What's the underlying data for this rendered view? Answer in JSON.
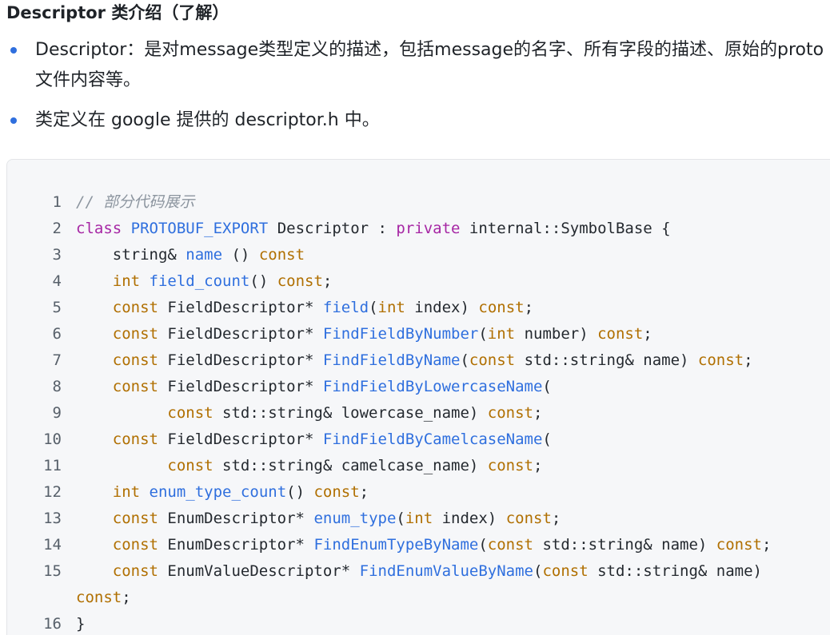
{
  "heading": "Descriptor 类介绍（了解）",
  "bullets": [
    "Descriptor：是对message类型定义的描述，包括message的名字、所有字段的描述、原始的proto文件内容等。",
    "类定义在 google 提供的 descriptor.h 中。"
  ],
  "code": {
    "lines": [
      {
        "num": "1",
        "tokens": [
          {
            "t": "// 部分代码展示",
            "c": "comment"
          }
        ]
      },
      {
        "num": "2",
        "tokens": [
          {
            "t": "class",
            "c": "keyword"
          },
          {
            "t": " ",
            "c": "plain"
          },
          {
            "t": "PROTOBUF_EXPORT",
            "c": "func"
          },
          {
            "t": " Descriptor : ",
            "c": "plain"
          },
          {
            "t": "private",
            "c": "keyword"
          },
          {
            "t": " internal::SymbolBase {",
            "c": "plain"
          }
        ]
      },
      {
        "num": "3",
        "tokens": [
          {
            "t": "    string& ",
            "c": "plain"
          },
          {
            "t": "name",
            "c": "func"
          },
          {
            "t": " () ",
            "c": "plain"
          },
          {
            "t": "const",
            "c": "type"
          }
        ]
      },
      {
        "num": "4",
        "tokens": [
          {
            "t": "    ",
            "c": "plain"
          },
          {
            "t": "int",
            "c": "type"
          },
          {
            "t": " ",
            "c": "plain"
          },
          {
            "t": "field_count",
            "c": "func"
          },
          {
            "t": "() ",
            "c": "plain"
          },
          {
            "t": "const",
            "c": "type"
          },
          {
            "t": ";",
            "c": "plain"
          }
        ]
      },
      {
        "num": "5",
        "tokens": [
          {
            "t": "    ",
            "c": "plain"
          },
          {
            "t": "const",
            "c": "type"
          },
          {
            "t": " FieldDescriptor* ",
            "c": "plain"
          },
          {
            "t": "field",
            "c": "func"
          },
          {
            "t": "(",
            "c": "plain"
          },
          {
            "t": "int",
            "c": "type"
          },
          {
            "t": " index) ",
            "c": "plain"
          },
          {
            "t": "const",
            "c": "type"
          },
          {
            "t": ";",
            "c": "plain"
          }
        ]
      },
      {
        "num": "6",
        "tokens": [
          {
            "t": "    ",
            "c": "plain"
          },
          {
            "t": "const",
            "c": "type"
          },
          {
            "t": " FieldDescriptor* ",
            "c": "plain"
          },
          {
            "t": "FindFieldByNumber",
            "c": "func"
          },
          {
            "t": "(",
            "c": "plain"
          },
          {
            "t": "int",
            "c": "type"
          },
          {
            "t": " number) ",
            "c": "plain"
          },
          {
            "t": "const",
            "c": "type"
          },
          {
            "t": ";",
            "c": "plain"
          }
        ]
      },
      {
        "num": "7",
        "tokens": [
          {
            "t": "    ",
            "c": "plain"
          },
          {
            "t": "const",
            "c": "type"
          },
          {
            "t": " FieldDescriptor* ",
            "c": "plain"
          },
          {
            "t": "FindFieldByName",
            "c": "func"
          },
          {
            "t": "(",
            "c": "plain"
          },
          {
            "t": "const",
            "c": "type"
          },
          {
            "t": " std::string& name) ",
            "c": "plain"
          },
          {
            "t": "const",
            "c": "type"
          },
          {
            "t": ";",
            "c": "plain"
          }
        ]
      },
      {
        "num": "8",
        "tokens": [
          {
            "t": "    ",
            "c": "plain"
          },
          {
            "t": "const",
            "c": "type"
          },
          {
            "t": " FieldDescriptor* ",
            "c": "plain"
          },
          {
            "t": "FindFieldByLowercaseName",
            "c": "func"
          },
          {
            "t": "(",
            "c": "plain"
          }
        ]
      },
      {
        "num": "9",
        "tokens": [
          {
            "t": "          ",
            "c": "plain"
          },
          {
            "t": "const",
            "c": "type"
          },
          {
            "t": " std::string& lowercase_name) ",
            "c": "plain"
          },
          {
            "t": "const",
            "c": "type"
          },
          {
            "t": ";",
            "c": "plain"
          }
        ]
      },
      {
        "num": "10",
        "tokens": [
          {
            "t": "    ",
            "c": "plain"
          },
          {
            "t": "const",
            "c": "type"
          },
          {
            "t": " FieldDescriptor* ",
            "c": "plain"
          },
          {
            "t": "FindFieldByCamelcaseName",
            "c": "func"
          },
          {
            "t": "(",
            "c": "plain"
          }
        ]
      },
      {
        "num": "11",
        "tokens": [
          {
            "t": "          ",
            "c": "plain"
          },
          {
            "t": "const",
            "c": "type"
          },
          {
            "t": " std::string& camelcase_name) ",
            "c": "plain"
          },
          {
            "t": "const",
            "c": "type"
          },
          {
            "t": ";",
            "c": "plain"
          }
        ]
      },
      {
        "num": "12",
        "tokens": [
          {
            "t": "    ",
            "c": "plain"
          },
          {
            "t": "int",
            "c": "type"
          },
          {
            "t": " ",
            "c": "plain"
          },
          {
            "t": "enum_type_count",
            "c": "func"
          },
          {
            "t": "() ",
            "c": "plain"
          },
          {
            "t": "const",
            "c": "type"
          },
          {
            "t": ";",
            "c": "plain"
          }
        ]
      },
      {
        "num": "13",
        "tokens": [
          {
            "t": "    ",
            "c": "plain"
          },
          {
            "t": "const",
            "c": "type"
          },
          {
            "t": " EnumDescriptor* ",
            "c": "plain"
          },
          {
            "t": "enum_type",
            "c": "func"
          },
          {
            "t": "(",
            "c": "plain"
          },
          {
            "t": "int",
            "c": "type"
          },
          {
            "t": " index) ",
            "c": "plain"
          },
          {
            "t": "const",
            "c": "type"
          },
          {
            "t": ";",
            "c": "plain"
          }
        ]
      },
      {
        "num": "14",
        "tokens": [
          {
            "t": "    ",
            "c": "plain"
          },
          {
            "t": "const",
            "c": "type"
          },
          {
            "t": " EnumDescriptor* ",
            "c": "plain"
          },
          {
            "t": "FindEnumTypeByName",
            "c": "func"
          },
          {
            "t": "(",
            "c": "plain"
          },
          {
            "t": "const",
            "c": "type"
          },
          {
            "t": " std::string& name) ",
            "c": "plain"
          },
          {
            "t": "const",
            "c": "type"
          },
          {
            "t": ";",
            "c": "plain"
          }
        ]
      },
      {
        "num": "15",
        "wrapped": true,
        "tokens": [
          {
            "t": "    ",
            "c": "plain"
          },
          {
            "t": "const",
            "c": "type"
          },
          {
            "t": " EnumValueDescriptor* ",
            "c": "plain"
          },
          {
            "t": "FindEnumValueByName",
            "c": "func"
          },
          {
            "t": "(",
            "c": "plain"
          },
          {
            "t": "const",
            "c": "type"
          },
          {
            "t": " std::string& name) ",
            "c": "plain"
          },
          {
            "t": "const",
            "c": "type"
          },
          {
            "t": ";",
            "c": "plain"
          }
        ]
      },
      {
        "num": "16",
        "tokens": [
          {
            "t": "}",
            "c": "plain"
          }
        ]
      }
    ]
  },
  "colors": {
    "bullet": "#2f6fde",
    "keyword": "#a626a4",
    "type": "#b06f00",
    "function": "#2f6fde",
    "comment": "#8c959f",
    "code_background": "#f6f7f9"
  }
}
